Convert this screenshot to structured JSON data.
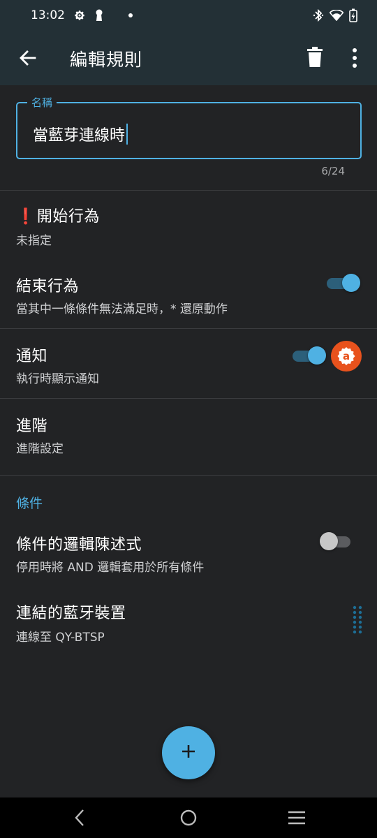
{
  "status_bar": {
    "time": "13:02",
    "icons": [
      "gear-icon",
      "keyhole-icon",
      "dot-icon",
      "bluetooth-icon",
      "wifi-icon",
      "battery-charging-icon"
    ]
  },
  "app_bar": {
    "title": "編輯規則",
    "icons": [
      "arrow-back-icon",
      "trash-icon",
      "more-vert-icon"
    ]
  },
  "name_field": {
    "label": "名稱",
    "value": "當藍芽連線時",
    "counter": "6/24"
  },
  "rows": {
    "start_action": {
      "title": "開始行為",
      "prefix": "❗",
      "subtitle": "未指定"
    },
    "end_action": {
      "title": "結束行為",
      "subtitle": "當其中一條條件無法滿足時，* 還原動作",
      "toggle_on": true
    },
    "notification": {
      "title": "通知",
      "subtitle": "執行時顯示通知",
      "toggle_on": true,
      "badge_letter": "a"
    },
    "advanced": {
      "title": "進階",
      "subtitle": "進階設定"
    }
  },
  "conditions": {
    "header": "條件",
    "logic": {
      "title": "條件的邏輯陳述式",
      "subtitle": "停用時將 AND 邏輯套用於所有條件",
      "toggle_on": false
    },
    "bluetooth": {
      "title": "連結的藍牙裝置",
      "subtitle": "連線至 QY-BTSP"
    }
  },
  "fab": {
    "icon": "plus-icon"
  },
  "nav_bar": {
    "icons": [
      "nav-back-icon",
      "nav-home-icon",
      "nav-recents-icon"
    ]
  },
  "colors": {
    "accent": "#4fb1e3",
    "app_bar": "#233036",
    "background": "#222325",
    "badge": "#e8521d",
    "warning": "#e53935"
  }
}
